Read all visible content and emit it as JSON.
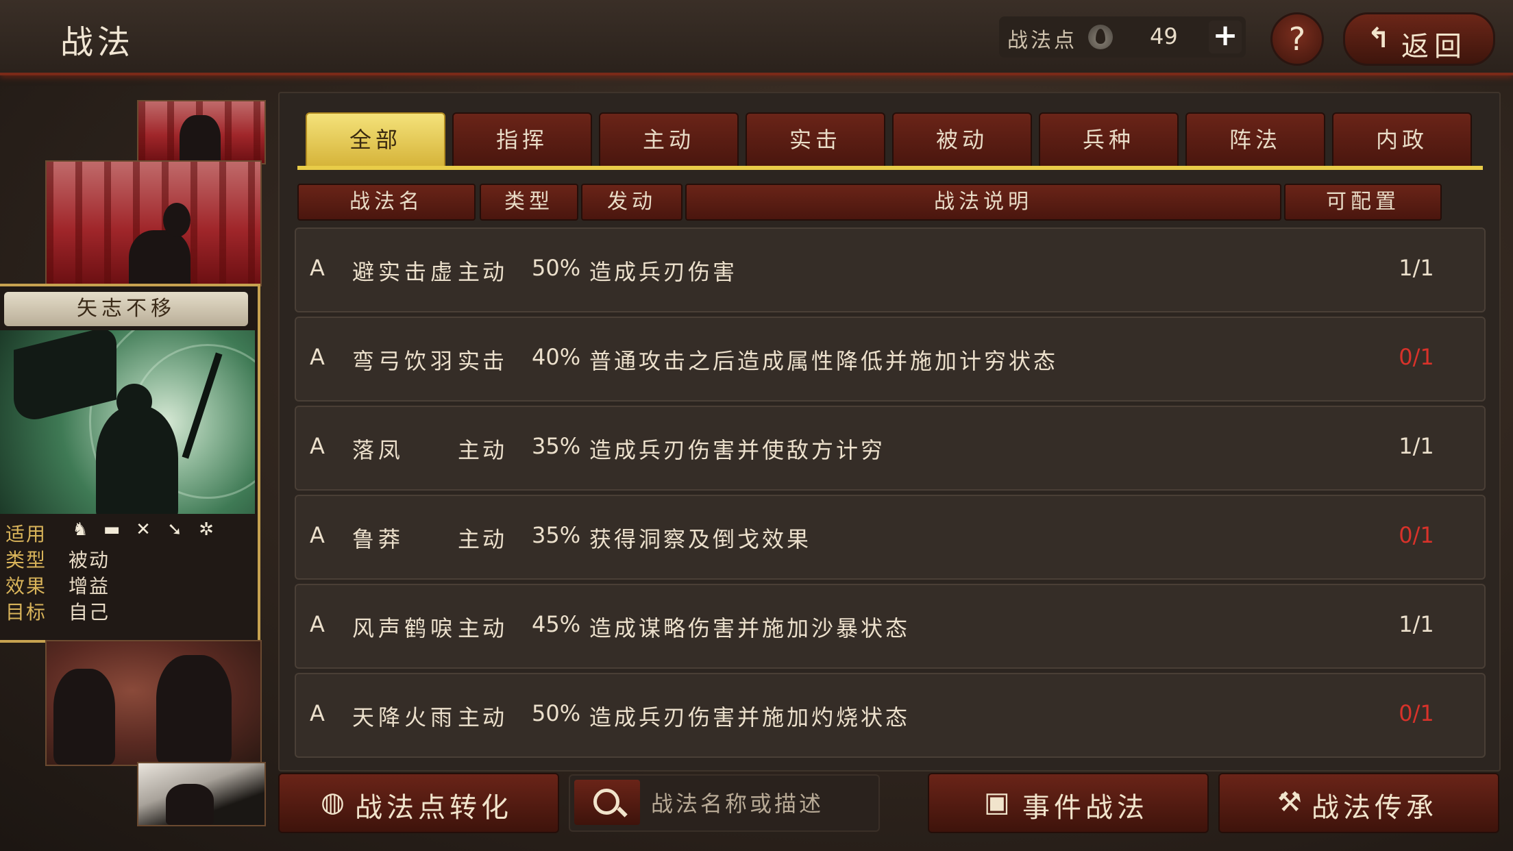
{
  "header": {
    "title": "战法",
    "points_label": "战法点",
    "points_value": "49",
    "plus": "+",
    "help": "?",
    "back_label": "返回",
    "back_icon": "↰"
  },
  "skill_card": {
    "title": "矢志不移",
    "rows": [
      {
        "label": "适用",
        "value": ""
      },
      {
        "label": "类型",
        "value": "被动"
      },
      {
        "label": "效果",
        "value": "增益"
      },
      {
        "label": "目标",
        "value": "自己"
      }
    ],
    "troop_icons": [
      "cavalry-icon",
      "shield-icon",
      "crossed-swords-icon",
      "spear-icon",
      "wheel-icon"
    ]
  },
  "tabs": [
    "全部",
    "指挥",
    "主动",
    "实击",
    "被动",
    "兵种",
    "阵法",
    "内政"
  ],
  "active_tab": 0,
  "columns": [
    "战法名",
    "类型",
    "发动",
    "战法说明",
    "可配置"
  ],
  "rows": [
    {
      "grade": "A",
      "name": "避实击虚",
      "type": "主动",
      "rate": "50%",
      "desc": "造成兵刃伤害",
      "config": "1/1",
      "config_full": false
    },
    {
      "grade": "A",
      "name": "弯弓饮羽",
      "type": "实击",
      "rate": "40%",
      "desc": "普通攻击之后造成属性降低并施加计穷状态",
      "config": "0/1",
      "config_full": true
    },
    {
      "grade": "A",
      "name": "落凤",
      "type": "主动",
      "rate": "35%",
      "desc": "造成兵刃伤害并使敌方计穷",
      "config": "1/1",
      "config_full": false
    },
    {
      "grade": "A",
      "name": "鲁莽",
      "type": "主动",
      "rate": "35%",
      "desc": "获得洞察及倒戈效果",
      "config": "0/1",
      "config_full": true
    },
    {
      "grade": "A",
      "name": "风声鹤唳",
      "type": "主动",
      "rate": "45%",
      "desc": "造成谋略伤害并施加沙暴状态",
      "config": "1/1",
      "config_full": false
    },
    {
      "grade": "A",
      "name": "天降火雨",
      "type": "主动",
      "rate": "50%",
      "desc": "造成兵刃伤害并施加灼烧状态",
      "config": "0/1",
      "config_full": true
    }
  ],
  "bottom": {
    "convert_label": "战法点转化",
    "search_placeholder": "战法名称或描述",
    "event_label": "事件战法",
    "inherit_label": "战法传承"
  },
  "colors": {
    "accent_gold": "#e8cc48",
    "tab_red": "#6a2418",
    "config_full": "#d8322a"
  }
}
